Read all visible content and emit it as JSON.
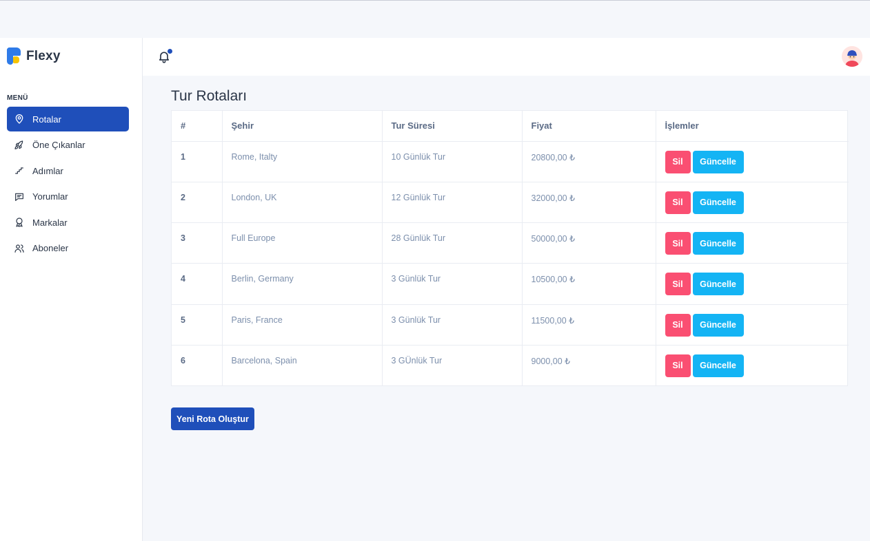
{
  "brand": {
    "name": "Flexy"
  },
  "sidebar": {
    "heading": "MENÜ",
    "items": [
      {
        "label": "Rotalar",
        "icon": "map-pin-icon",
        "active": true
      },
      {
        "label": "Öne Çıkanlar",
        "icon": "rocket-icon",
        "active": false
      },
      {
        "label": "Adımlar",
        "icon": "stairs-icon",
        "active": false
      },
      {
        "label": "Yorumlar",
        "icon": "message-icon",
        "active": false
      },
      {
        "label": "Markalar",
        "icon": "badge-icon",
        "active": false
      },
      {
        "label": "Aboneler",
        "icon": "users-icon",
        "active": false
      }
    ]
  },
  "header": {
    "notification_icon": "bell-icon",
    "avatar_icon": "user-avatar-icon"
  },
  "main": {
    "title": "Tur Rotaları",
    "table": {
      "columns": [
        "#",
        "Şehir",
        "Tur Süresi",
        "Fiyat",
        "İşlemler"
      ],
      "rows": [
        {
          "id": "1",
          "city": "Rome, Italty",
          "duration": "10 Günlük Tur",
          "price": "20800,00 ₺"
        },
        {
          "id": "2",
          "city": "London, UK",
          "duration": "12 Günlük Tur",
          "price": "32000,00 ₺"
        },
        {
          "id": "3",
          "city": "Full Europe",
          "duration": "28 Günlük Tur",
          "price": "50000,00 ₺"
        },
        {
          "id": "4",
          "city": "Berlin, Germany",
          "duration": "3 Günlük Tur",
          "price": "10500,00 ₺"
        },
        {
          "id": "5",
          "city": "Paris, France",
          "duration": "3 Günlük Tur",
          "price": "11500,00 ₺"
        },
        {
          "id": "6",
          "city": "Barcelona, Spain",
          "duration": "3 GÜnlük Tur",
          "price": "9000,00 ₺"
        }
      ],
      "delete_label": "Sil",
      "update_label": "Güncelle"
    },
    "new_route_label": "Yeni Rota Oluştur"
  },
  "colors": {
    "primary": "#1f4fba",
    "danger": "#fa4f72",
    "info": "#14b4f4",
    "brand_blue": "#2f7be8",
    "brand_yellow": "#f7c400"
  }
}
